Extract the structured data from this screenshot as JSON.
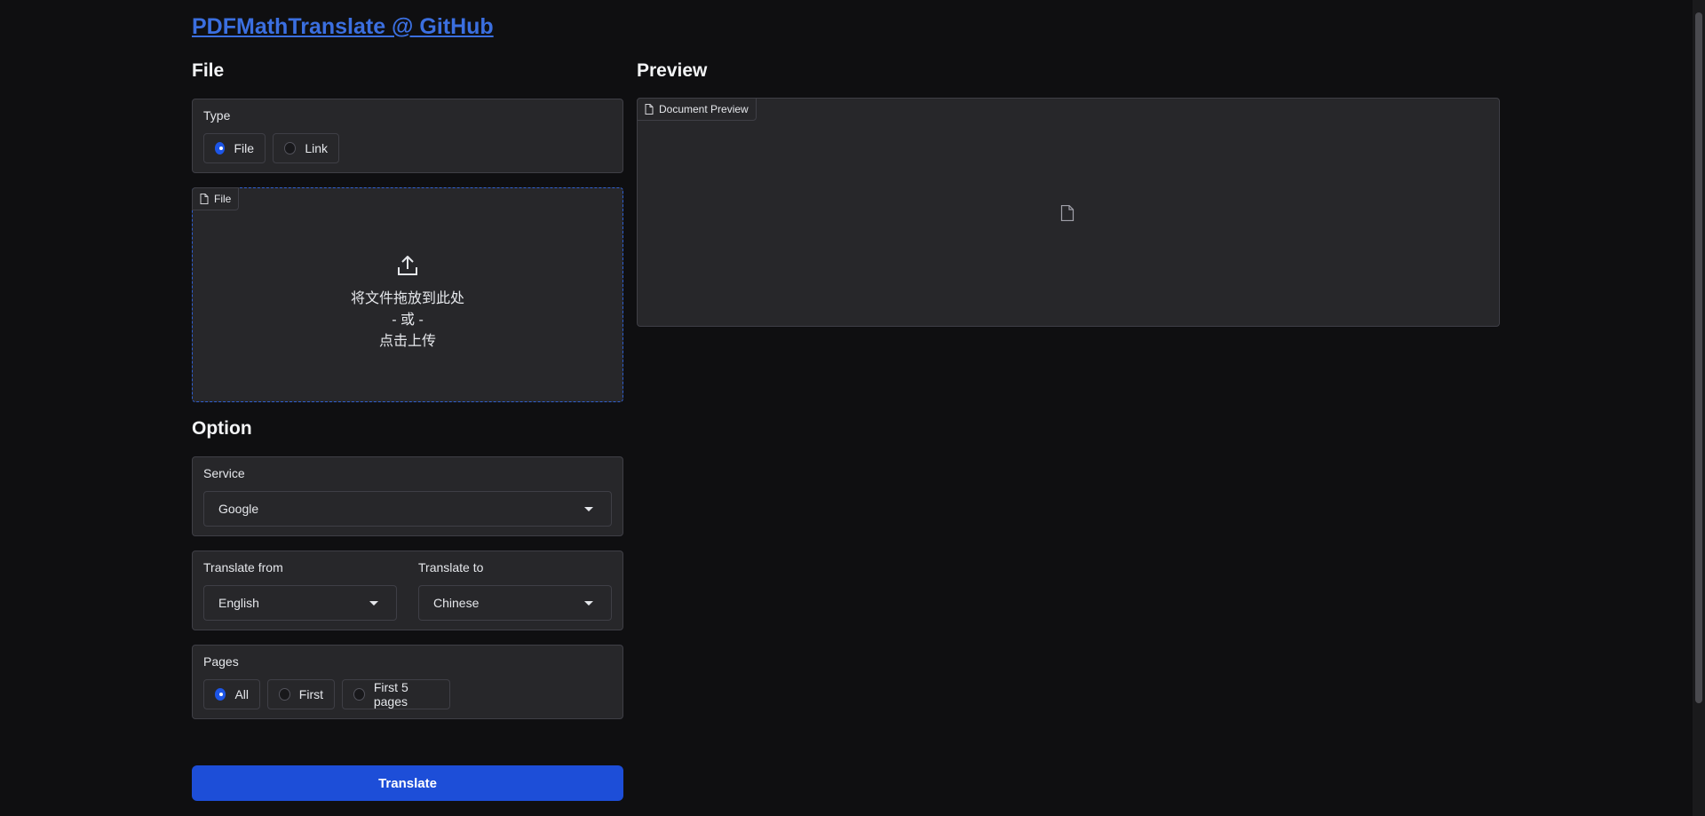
{
  "header": {
    "title_link": "PDFMathTranslate @ GitHub"
  },
  "file_section": {
    "title": "File",
    "type_label": "Type",
    "type_options": [
      {
        "label": "File",
        "checked": true
      },
      {
        "label": "Link",
        "checked": false
      }
    ],
    "upload": {
      "tag": "File",
      "drop_text": "将文件拖放到此处",
      "or_text": "- 或 -",
      "click_text": "点击上传"
    }
  },
  "option_section": {
    "title": "Option",
    "service": {
      "label": "Service",
      "value": "Google"
    },
    "translate_from": {
      "label": "Translate from",
      "value": "English"
    },
    "translate_to": {
      "label": "Translate to",
      "value": "Chinese"
    },
    "pages": {
      "label": "Pages",
      "options": [
        {
          "label": "All",
          "checked": true
        },
        {
          "label": "First",
          "checked": false
        },
        {
          "label": "First 5 pages",
          "checked": false
        }
      ]
    }
  },
  "translate_button": "Translate",
  "preview_section": {
    "title": "Preview",
    "tag": "Document Preview"
  },
  "colors": {
    "background": "#0f0f11",
    "panel": "#27272a",
    "accent": "#1d4ed8",
    "link": "#3b6fe0"
  }
}
